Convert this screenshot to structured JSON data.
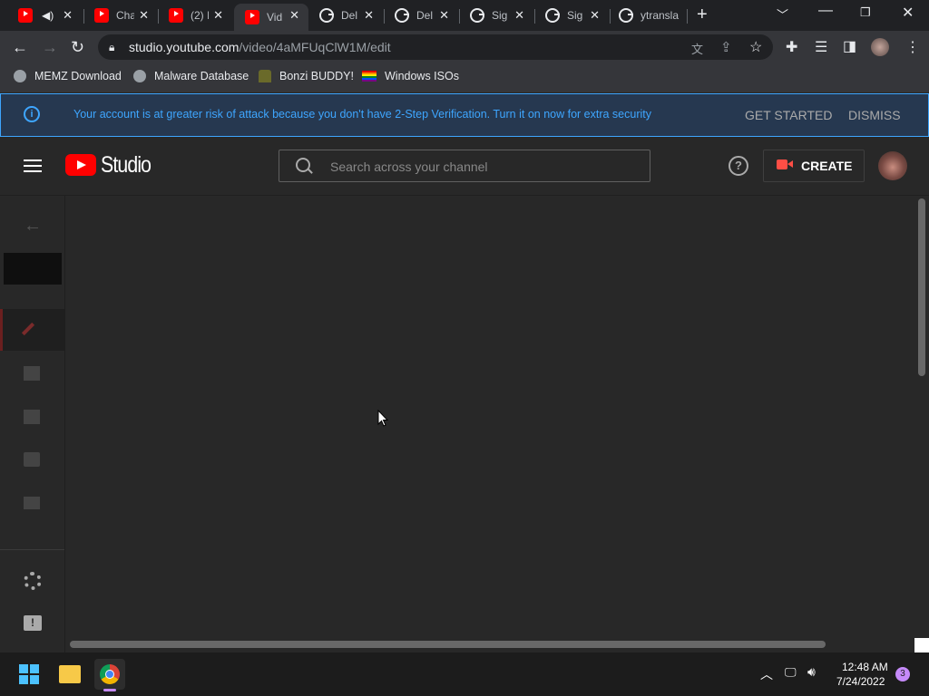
{
  "browser": {
    "tabs": [
      {
        "title": "",
        "favicon": "youtube-icon",
        "audio": true
      },
      {
        "title": "Cha",
        "favicon": "youtube-icon"
      },
      {
        "title": "(2) I",
        "favicon": "youtube-icon"
      },
      {
        "title": "Vid",
        "favicon": "youtube-icon",
        "active": true
      },
      {
        "title": "Del",
        "favicon": "google-icon"
      },
      {
        "title": "Del",
        "favicon": "google-icon"
      },
      {
        "title": "Sig",
        "favicon": "google-icon"
      },
      {
        "title": "Sig",
        "favicon": "google-icon"
      },
      {
        "title": "ytransla",
        "favicon": "google-icon"
      }
    ],
    "new_tab": "+",
    "url_host": "studio.youtube.com",
    "url_path": "/video/4aMFUqClW1M/edit",
    "bookmarks": [
      {
        "label": "MEMZ Download",
        "icon": "globe-icon"
      },
      {
        "label": "Malware Database",
        "icon": "globe-icon"
      },
      {
        "label": "Bonzi BUDDY!",
        "icon": "bonzi-icon"
      },
      {
        "label": "Windows ISOs",
        "icon": "rainbow-flag-icon"
      }
    ]
  },
  "banner": {
    "text": "Your account is at greater risk of attack because you don't have 2-Step Verification. Turn it on now for extra security",
    "get_started": "GET STARTED",
    "dismiss": "DISMISS",
    "info": "i"
  },
  "studio": {
    "logo_text": "Studio",
    "search_placeholder": "Search across your channel",
    "help": "?",
    "create_label": "CREATE"
  },
  "taskbar": {
    "time": "12:48 AM",
    "date": "7/24/2022",
    "notification_count": "3"
  },
  "colors": {
    "banner_text": "#3ea6ff",
    "youtube_red": "#ff0000",
    "background": "#282828"
  }
}
